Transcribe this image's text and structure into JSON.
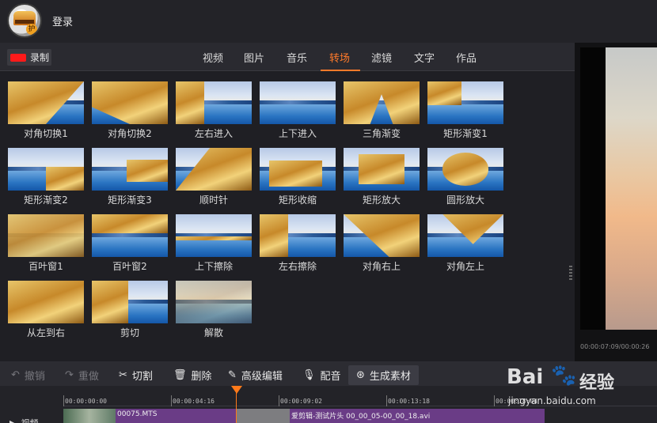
{
  "header": {
    "login_label": "登录"
  },
  "nav": {
    "record_label": "录制",
    "tabs": [
      {
        "label": "视频"
      },
      {
        "label": "图片"
      },
      {
        "label": "音乐"
      },
      {
        "label": "转场",
        "active": true
      },
      {
        "label": "滤镜"
      },
      {
        "label": "文字"
      },
      {
        "label": "作品"
      }
    ],
    "accent_color": "#ff7a2a"
  },
  "transitions": [
    {
      "label": "对角切换1"
    },
    {
      "label": "对角切换2"
    },
    {
      "label": "左右进入"
    },
    {
      "label": "上下进入"
    },
    {
      "label": "三角渐变"
    },
    {
      "label": "矩形渐变1"
    },
    {
      "label": "矩形渐变2"
    },
    {
      "label": "矩形渐变3"
    },
    {
      "label": "顺时针"
    },
    {
      "label": "矩形收缩"
    },
    {
      "label": "矩形放大"
    },
    {
      "label": "圆形放大"
    },
    {
      "label": "百叶窗1"
    },
    {
      "label": "百叶窗2"
    },
    {
      "label": "上下擦除"
    },
    {
      "label": "左右擦除"
    },
    {
      "label": "对角右上"
    },
    {
      "label": "对角左上"
    },
    {
      "label": "从左到右"
    },
    {
      "label": "剪切"
    },
    {
      "label": "解散"
    }
  ],
  "preview": {
    "timecode": "00:00:07:09/00:00:26"
  },
  "toolbar": {
    "undo_label": "撤销",
    "redo_label": "重做",
    "cut_label": "切割",
    "delete_label": "删除",
    "advanced_edit_label": "高级编辑",
    "dub_label": "配音",
    "generate_label": "生成素材"
  },
  "timeline": {
    "ticks": [
      "00:00:00:00",
      "00:00:04:16",
      "00:00:09:02",
      "00:00:13:18",
      "00:00:18:04"
    ],
    "track_label": "视频",
    "clips": [
      {
        "label": "00075.MTS"
      },
      {
        "label": "爱剪辑-测试片头 00_00_05-00_00_18.avi"
      }
    ]
  },
  "watermark": {
    "brand": "Bai",
    "brand_cn": "经验",
    "url": "jingyan.baidu.com"
  }
}
